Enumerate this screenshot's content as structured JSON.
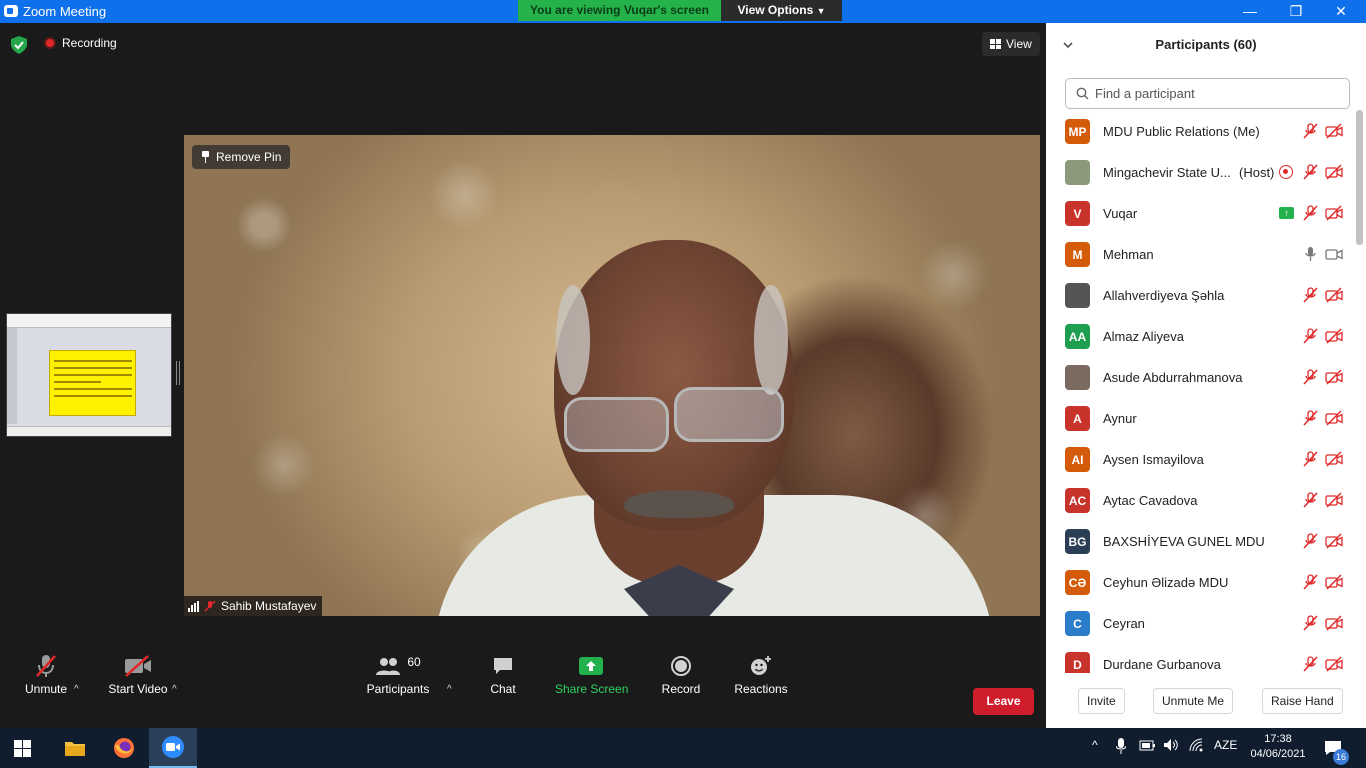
{
  "window": {
    "title": "Zoom Meeting",
    "banner": "You are viewing Vuqar's screen",
    "view_options": "View Options"
  },
  "top_bar": {
    "recording": "Recording",
    "view": "View"
  },
  "video": {
    "remove_pin": "Remove Pin",
    "speaker": "Sahib Mustafayev"
  },
  "toolbar": {
    "unmute": "Unmute",
    "start_video": "Start Video",
    "participants": "Participants",
    "participants_count": "60",
    "chat": "Chat",
    "share_screen": "Share Screen",
    "record": "Record",
    "reactions": "Reactions",
    "leave": "Leave"
  },
  "panel": {
    "title": "Participants (60)",
    "search_placeholder": "Find a participant",
    "host_tag": "(Host)",
    "participants": [
      {
        "initials": "MP",
        "name": "MDU Public Relations (Me)",
        "color": "#d45b0a",
        "muted": true,
        "video_off": true
      },
      {
        "initials": "",
        "name": "Mingachevir State U...",
        "color": "#8a9a7a",
        "muted": true,
        "video_off": true,
        "host": true,
        "recording": true
      },
      {
        "initials": "V",
        "name": "Vuqar",
        "color": "#c8332b",
        "muted": true,
        "video_off": true,
        "sharing": true
      },
      {
        "initials": "M",
        "name": "Mehman",
        "color": "#d45b0a",
        "muted": false,
        "video_off": false
      },
      {
        "initials": "",
        "name": "Allahverdiyeva Şəhla",
        "color": "#555555",
        "muted": true,
        "video_off": true
      },
      {
        "initials": "AA",
        "name": "Almaz Aliyeva",
        "color": "#1e9e4f",
        "muted": true,
        "video_off": true
      },
      {
        "initials": "",
        "name": "Asude Abdurrahmanova",
        "color": "#7a6a60",
        "muted": true,
        "video_off": true
      },
      {
        "initials": "A",
        "name": "Aynur",
        "color": "#c8332b",
        "muted": true,
        "video_off": true
      },
      {
        "initials": "AI",
        "name": "Aysen Ismayilova",
        "color": "#d45b0a",
        "muted": true,
        "video_off": true
      },
      {
        "initials": "AC",
        "name": "Aytac Cavadova",
        "color": "#c8332b",
        "muted": true,
        "video_off": true
      },
      {
        "initials": "BG",
        "name": "BAXSHİYEVA GUNEL MDU",
        "color": "#2c3e55",
        "muted": true,
        "video_off": true
      },
      {
        "initials": "CƏ",
        "name": "Ceyhun Əlizadə MDU",
        "color": "#d45b0a",
        "muted": true,
        "video_off": true
      },
      {
        "initials": "C",
        "name": "Ceyran",
        "color": "#2b7cc9",
        "muted": true,
        "video_off": true
      },
      {
        "initials": "D",
        "name": "Durdane Gurbanova",
        "color": "#c8332b",
        "muted": true,
        "video_off": true
      }
    ],
    "buttons": {
      "invite": "Invite",
      "unmute_me": "Unmute Me",
      "raise_hand": "Raise Hand"
    }
  },
  "taskbar": {
    "language": "AZE",
    "time": "17:38",
    "date": "04/06/2021",
    "notifications": "16"
  }
}
